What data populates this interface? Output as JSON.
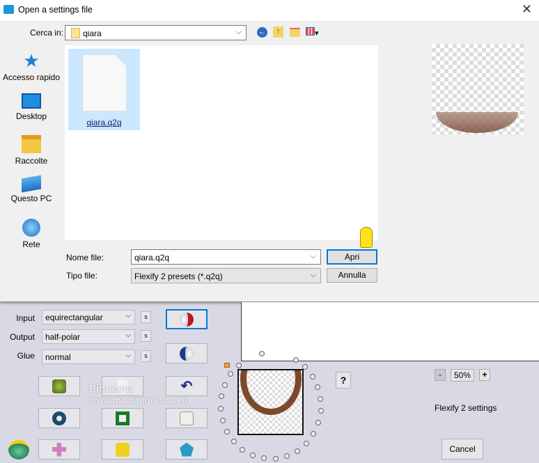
{
  "dialog": {
    "title": "Open a settings file",
    "look_in_label": "Cerca in:",
    "look_in_value": "qiara",
    "places": [
      {
        "label": "Accesso rapido",
        "icon": "star-icon"
      },
      {
        "label": "Desktop",
        "icon": "desktop-icon"
      },
      {
        "label": "Raccolte",
        "icon": "libraries-icon"
      },
      {
        "label": "Questo PC",
        "icon": "computer-icon"
      },
      {
        "label": "Rete",
        "icon": "network-icon"
      }
    ],
    "files": [
      {
        "name": "qiara.q2q",
        "selected": true
      }
    ],
    "filename_label": "Nome file:",
    "filename_value": "qiara.q2q",
    "filetype_label": "Tipo file:",
    "filetype_value": "Flexify 2 presets (*.q2q)",
    "open_label": "Apri",
    "cancel_label": "Annulla"
  },
  "plugin": {
    "input_label": "Input",
    "input_value": "equirectangular",
    "output_label": "Output",
    "output_value": "half-polar",
    "glue_label": "Glue",
    "glue_value": "normal",
    "s_label": "s",
    "zoom_minus": "-",
    "zoom_value": "50%",
    "zoom_plus": "+",
    "help_label": "?",
    "settings_label": "Flexify 2 settings",
    "cancel_label": "Cancel"
  },
  "watermark": {
    "line1": "Pinuccia",
    "line2": "www.maidiregrafica.eu"
  },
  "colors": {
    "accent": "#0078d7",
    "selection": "#cce8ff",
    "plugin_bg": "#d9d9e5"
  }
}
